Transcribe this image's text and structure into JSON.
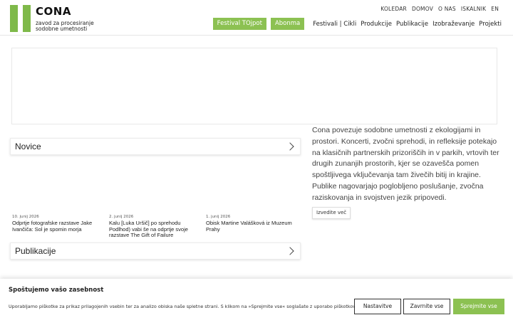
{
  "logo": {
    "title": "CONA",
    "subtitle_line1": "zavod za procesiranje",
    "subtitle_line2": "sodobne umetnosti"
  },
  "top_nav": [
    "KOLEDAR",
    "DOMOV",
    "O NAS",
    "ISKALNIK",
    "EN"
  ],
  "main_nav": {
    "highlight": [
      "Festival TOjpot",
      "Abonma"
    ],
    "links": [
      "Festivali | Cikli",
      "Produkcije",
      "Publikacije",
      "Izobraževanje",
      "Projekti"
    ]
  },
  "sections": {
    "novice": "Novice",
    "publikacije": "Publikacije"
  },
  "news": [
    {
      "date": "10. junij 2026",
      "title": "Odprtje fotografske razstave Jake Ivančiča: Sol je spomin morja"
    },
    {
      "date": "2. junij 2026",
      "title": "Kalu [Luka Uršič] po sprehodu Podlhod) vabi še na odprtje svoje razstave The Gift of Failure"
    },
    {
      "date": "1. junij 2026",
      "title": "Obisk Martine Valášková iz Muzeum Prahy"
    }
  ],
  "about": {
    "text": "Cona povezuje sodobne umetnosti z ekologijami in prostori. Koncerti, zvočni sprehodi, in refleksije potekajo na klasičnih partnerskih prizoriščih in v parkih, vrtovih ter drugih zunanjih prostorih, kjer se ozavešča pomen spoštljivega vključevanja tam živečih bitij in krajine. Publike nagovarjajo poglobljeno poslušanje, zvočna raziskovanja in svojstven jezik pripovedi.",
    "more_label": "Izvedite več"
  },
  "cookie": {
    "title": "Spoštujemo vašo zasebnost",
    "text": "Uporabljamo piškotke za prikaz prilagojenih vsebin ter za analizo obiska naše spletne strani. S klikom na »Sprejmite vse« soglašate z uporabo piškotkov.",
    "settings_label": "Nastavitve",
    "reject_label": "Zavrnite vse",
    "accept_label": "Sprejmite vse"
  },
  "colors": {
    "accent": "#8cc152",
    "logo_green": "#7fb94a"
  }
}
